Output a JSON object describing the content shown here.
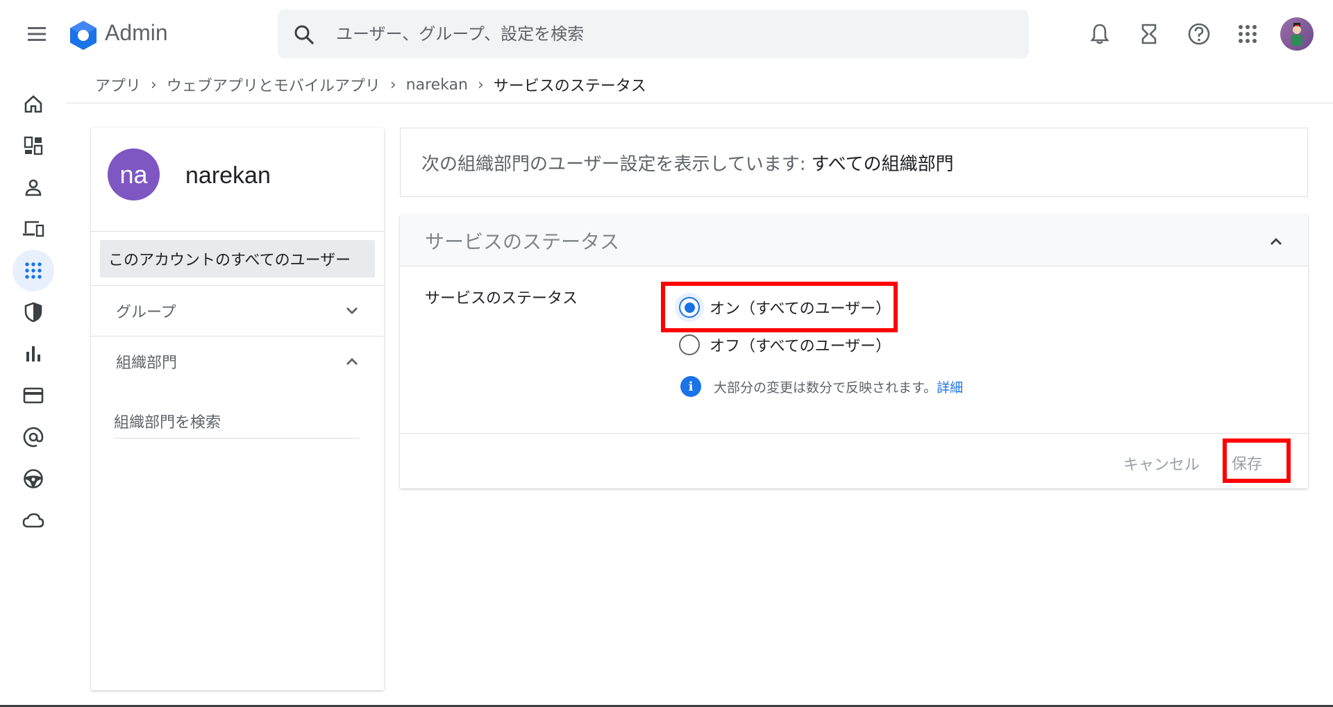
{
  "header": {
    "app_name": "Admin",
    "search_placeholder": "ユーザー、グループ、設定を検索"
  },
  "breadcrumb": {
    "items": [
      "アプリ",
      "ウェブアプリとモバイルアプリ",
      "narekan"
    ],
    "current": "サービスのステータス",
    "separator": "›"
  },
  "org": {
    "avatar_initials": "na",
    "name": "narekan",
    "all_users_label": "このアカウントのすべてのユーザー",
    "groups_label": "グループ",
    "ou_label": "組織部門",
    "ou_search_placeholder": "組織部門を検索"
  },
  "info_card": {
    "prefix": "次の組織部門のユーザー設定を表示しています: ",
    "org_unit": "すべての組織部門"
  },
  "status_card": {
    "title": "サービスのステータス",
    "setting_label": "サービスのステータス",
    "option_on": "オン（すべてのユーザー）",
    "option_off": "オフ（すべてのユーザー）",
    "selected": "on",
    "note_text": "大部分の変更は数分で反映されます。",
    "note_link": "詳細",
    "cancel_label": "キャンセル",
    "save_label": "保存"
  },
  "colors": {
    "accent": "#1a73e8",
    "highlight": "#ff0000",
    "org_avatar": "#7e57c2"
  }
}
